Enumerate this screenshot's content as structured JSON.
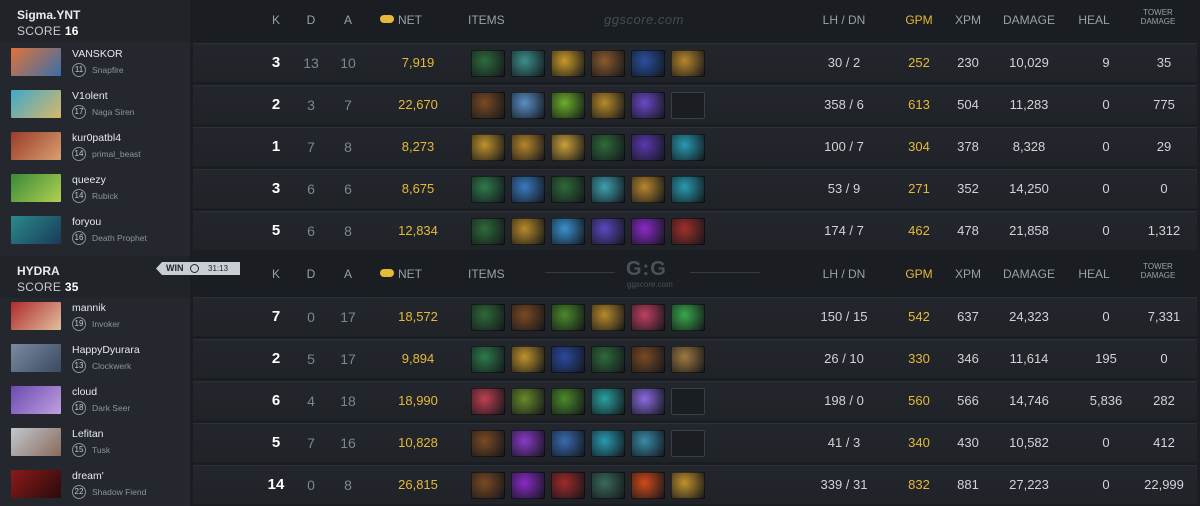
{
  "headers": {
    "k": "K",
    "d": "D",
    "a": "A",
    "net": "NET",
    "items": "ITEMS",
    "lh_dn": "LH  /  DN",
    "gpm": "GPM",
    "xpm": "XPM",
    "damage": "DAMAGE",
    "heal": "HEAL",
    "tower_damage_1": "TOWER",
    "tower_damage_2": "DAMAGE"
  },
  "watermarks": {
    "top": "ggscore.com",
    "logo": "G:G",
    "sub": "ggscore.com"
  },
  "win_badge": {
    "label": "WIN",
    "time": "31:13"
  },
  "teams": [
    {
      "name": "Sigma.YNT",
      "score_label": "SCORE",
      "score": "16",
      "players": [
        {
          "name": "VANSKOR",
          "level": "11",
          "hero": "Snapfire",
          "k": "3",
          "d": "13",
          "a": "10",
          "net": "7,919",
          "lh": "30",
          "dn": "2",
          "gpm": "252",
          "xpm": "230",
          "damage": "10,029",
          "heal": "9",
          "tower": "35",
          "portrait": [
            "#e0733a",
            "#3a6fa8"
          ],
          "items": [
            "#2d6b3c",
            "#3c8f8a",
            "#c99a2a",
            "#8a5a2e",
            "#2a4fa0",
            "#b8862c"
          ]
        },
        {
          "name": "V1olent",
          "level": "17",
          "hero": "Naga Siren",
          "k": "2",
          "d": "3",
          "a": "7",
          "net": "22,670",
          "lh": "358",
          "dn": "6",
          "gpm": "613",
          "xpm": "504",
          "damage": "11,283",
          "heal": "0",
          "tower": "775",
          "portrait": [
            "#3fa9c9",
            "#d8b86a"
          ],
          "items": [
            "#7a4a24",
            "#5b8fc4",
            "#6cae2a",
            "#b88a2a",
            "#6b48c8",
            "empty"
          ]
        },
        {
          "name": "kur0patbl4",
          "level": "14",
          "hero": "primal_beast",
          "k": "1",
          "d": "7",
          "a": "8",
          "net": "8,273",
          "lh": "100",
          "dn": "7",
          "gpm": "304",
          "xpm": "378",
          "damage": "8,328",
          "heal": "0",
          "tower": "29",
          "portrait": [
            "#9a3a2a",
            "#d9a070"
          ],
          "items": [
            "#c0922c",
            "#b8862c",
            "#caa03a",
            "#2f6a3a",
            "#5a38b0",
            "#2a9ab0"
          ]
        },
        {
          "name": "queezy",
          "level": "14",
          "hero": "Rubick",
          "k": "3",
          "d": "6",
          "a": "6",
          "net": "8,675",
          "lh": "53",
          "dn": "9",
          "gpm": "271",
          "xpm": "352",
          "damage": "14,250",
          "heal": "0",
          "tower": "0",
          "portrait": [
            "#3a8a3a",
            "#b0d050"
          ],
          "items": [
            "#2f7a4c",
            "#3a7ac0",
            "#2f6a3a",
            "#3fa0b0",
            "#b8862c",
            "#2a9ab0"
          ]
        },
        {
          "name": "foryou",
          "level": "16",
          "hero": "Death Prophet",
          "k": "5",
          "d": "6",
          "a": "8",
          "net": "12,834",
          "lh": "174",
          "dn": "7",
          "gpm": "462",
          "xpm": "478",
          "damage": "21,858",
          "heal": "0",
          "tower": "1,312",
          "portrait": [
            "#2a8a8a",
            "#1a3a5a"
          ],
          "items": [
            "#2f6a3a",
            "#b88a2a",
            "#3a90d0",
            "#5a48c0",
            "#8a2ac8",
            "#a0302a"
          ]
        }
      ]
    },
    {
      "name": "HYDRA",
      "score_label": "SCORE",
      "score": "35",
      "players": [
        {
          "name": "mannik",
          "level": "19",
          "hero": "Invoker",
          "k": "7",
          "d": "0",
          "a": "17",
          "net": "18,572",
          "lh": "150",
          "dn": "15",
          "gpm": "542",
          "xpm": "637",
          "damage": "24,323",
          "heal": "0",
          "tower": "7,331",
          "portrait": [
            "#b02a2a",
            "#e0c0a0"
          ],
          "items": [
            "#2f6a3a",
            "#7a4a24",
            "#4a8a2a",
            "#b88a2a",
            "#c04060",
            "#3aa84a"
          ]
        },
        {
          "name": "HappyDyurara",
          "level": "13",
          "hero": "Clockwerk",
          "k": "2",
          "d": "5",
          "a": "17",
          "net": "9,894",
          "lh": "26",
          "dn": "10",
          "gpm": "330",
          "xpm": "346",
          "damage": "11,614",
          "heal": "195",
          "tower": "0",
          "portrait": [
            "#7a8aa0",
            "#3a4a60"
          ],
          "items": [
            "#2f7a4c",
            "#c0922c",
            "#2a4aa0",
            "#2f6a3a",
            "#7a4a24",
            "#a07a40"
          ]
        },
        {
          "name": "cloud",
          "level": "18",
          "hero": "Dark Seer",
          "k": "6",
          "d": "4",
          "a": "18",
          "net": "18,990",
          "lh": "198",
          "dn": "0",
          "gpm": "560",
          "xpm": "566",
          "damage": "14,746",
          "heal": "5,836",
          "tower": "282",
          "portrait": [
            "#6a4ab0",
            "#c0a0e0"
          ],
          "items": [
            "#c04050",
            "#6a8a2a",
            "#4a8a2a",
            "#2aa0a0",
            "#8a6ae0",
            "empty"
          ]
        },
        {
          "name": "Lefitan",
          "level": "15",
          "hero": "Tusk",
          "k": "5",
          "d": "7",
          "a": "16",
          "net": "10,828",
          "lh": "41",
          "dn": "3",
          "gpm": "340",
          "xpm": "430",
          "damage": "10,582",
          "heal": "0",
          "tower": "412",
          "portrait": [
            "#c0c8d0",
            "#8a6a5a"
          ],
          "items": [
            "#7a4a24",
            "#8a3ac8",
            "#3a6ab0",
            "#2a9ab0",
            "#3a8aa8",
            "empty"
          ]
        },
        {
          "name": "dream'",
          "level": "22",
          "hero": "Shadow Fiend",
          "k": "14",
          "d": "0",
          "a": "8",
          "net": "26,815",
          "lh": "339",
          "dn": "31",
          "gpm": "832",
          "xpm": "881",
          "damage": "27,223",
          "heal": "0",
          "tower": "22,999",
          "portrait": [
            "#8a1a1a",
            "#2a0a0a"
          ],
          "items": [
            "#7a4a24",
            "#8a2ac8",
            "#a02a2a",
            "#3a6a5a",
            "#d04a1a",
            "#c0922c"
          ]
        }
      ]
    }
  ]
}
